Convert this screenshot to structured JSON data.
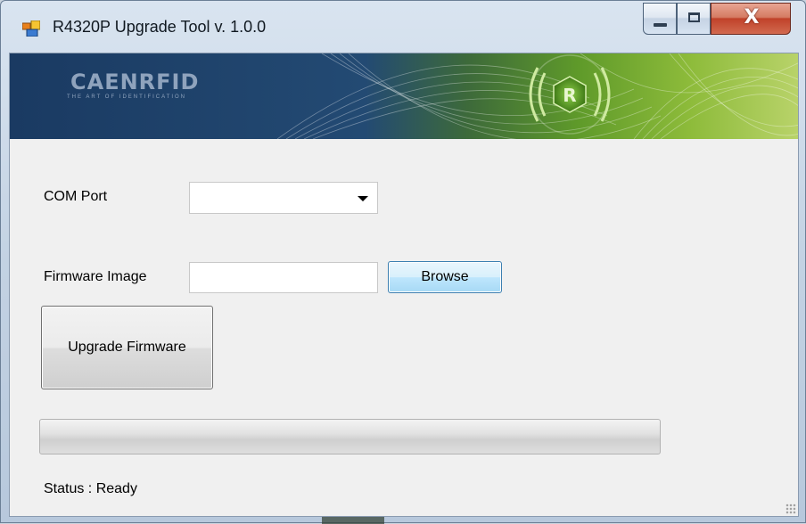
{
  "window": {
    "title": "R4320P Upgrade Tool v. 1.0.0",
    "close_glyph": "X"
  },
  "banner": {
    "logo_text": "CAENRFID",
    "tagline": "THE ART OF IDENTIFICATION",
    "badge_glyph": "R"
  },
  "form": {
    "com_port_label": "COM Port",
    "com_port_value": "",
    "firmware_label": "Firmware Image",
    "firmware_value": "",
    "browse_label": "Browse",
    "upgrade_label": "Upgrade Firmware"
  },
  "progress": {
    "value": 0
  },
  "status": {
    "text": "Status : Ready"
  },
  "colors": {
    "banner_dark": "#1f3f66",
    "banner_green": "#6aa12a",
    "badge_green": "#4d8a1e",
    "accent_button_border": "#3c7fb1"
  },
  "icons": {
    "app": "window-app-icon",
    "minimize": "minimize-icon",
    "maximize": "maximize-icon",
    "close": "close-icon",
    "dropdown": "chevron-down-icon",
    "size_grip": "size-grip-icon"
  }
}
